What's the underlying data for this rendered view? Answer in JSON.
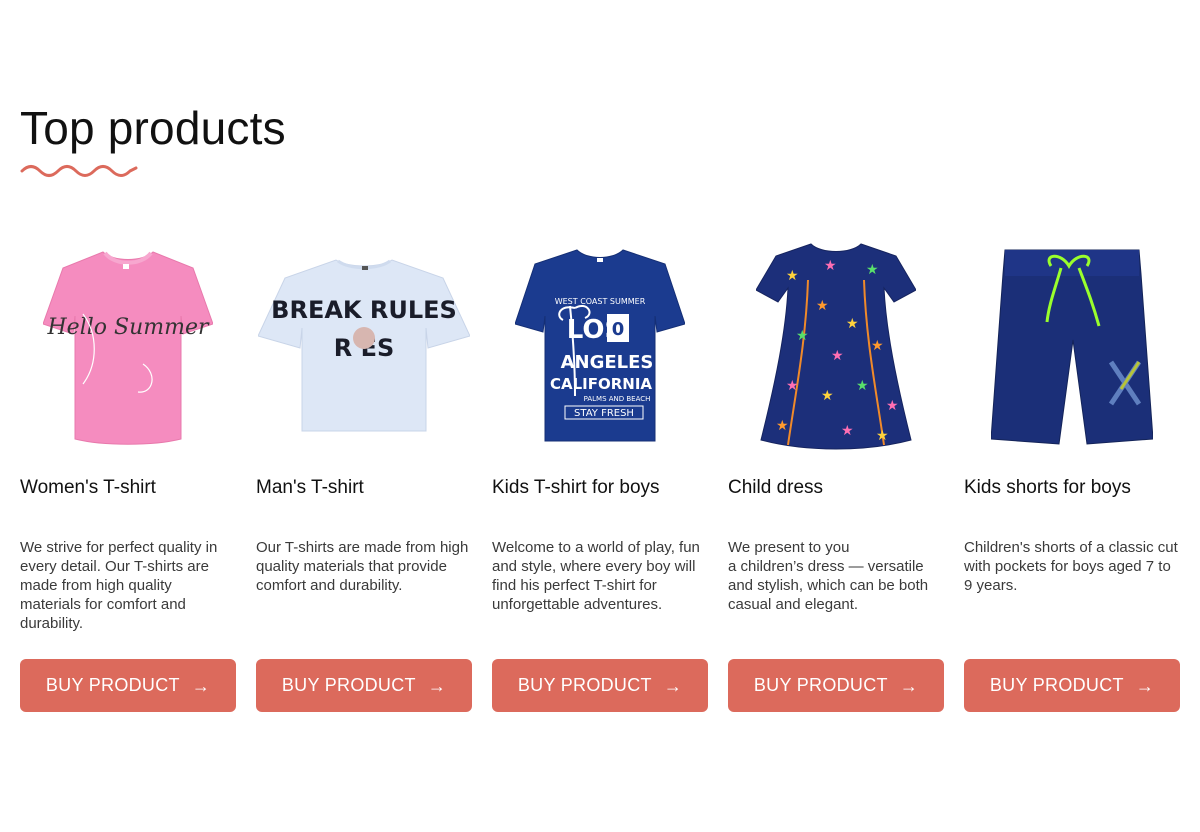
{
  "section": {
    "title": "Top products",
    "accent_color": "#dc6a5c"
  },
  "products": [
    {
      "name": "Women's T-shirt",
      "description": "We strive for perfect quality in every detail. Our T-shirts are made from high quality materials for comfort and durability.",
      "button_label": "BUY PRODUCT",
      "image": "pink-tshirt-hello-summer",
      "image_text": "Hello Summer"
    },
    {
      "name": "Man's T-shirt",
      "description": "Our T-shirts are made from high quality materials that provide comfort and durability.",
      "button_label": "BUY PRODUCT",
      "image": "white-tshirt-break-rules",
      "image_text": "BREAK RULES"
    },
    {
      "name": "Kids T-shirt for boys",
      "description": "Welcome to a world of play, fun and style, where every boy will find his perfect T-shirt for unforgettable adventures.",
      "button_label": "BUY PRODUCT",
      "image": "navy-tshirt-los-angeles",
      "image_text": [
        "WEST COAST SUMMER",
        "LOS",
        "ANGELES",
        "CALIFORNIA",
        "PALMS AND BEACH",
        "STAY FRESH"
      ]
    },
    {
      "name": "Child dress",
      "description": "We present to you\na children’s dress — versatile and stylish, which can be both casual and elegant.",
      "button_label": "BUY PRODUCT",
      "image": "star-print-dress"
    },
    {
      "name": "Kids shorts for boys",
      "description": "Children's shorts of a classic cut with pockets for boys aged 7 to 9 years.",
      "button_label": "BUY PRODUCT",
      "image": "navy-shorts"
    }
  ],
  "icons": {
    "button_arrow": "arrow-right-icon"
  }
}
